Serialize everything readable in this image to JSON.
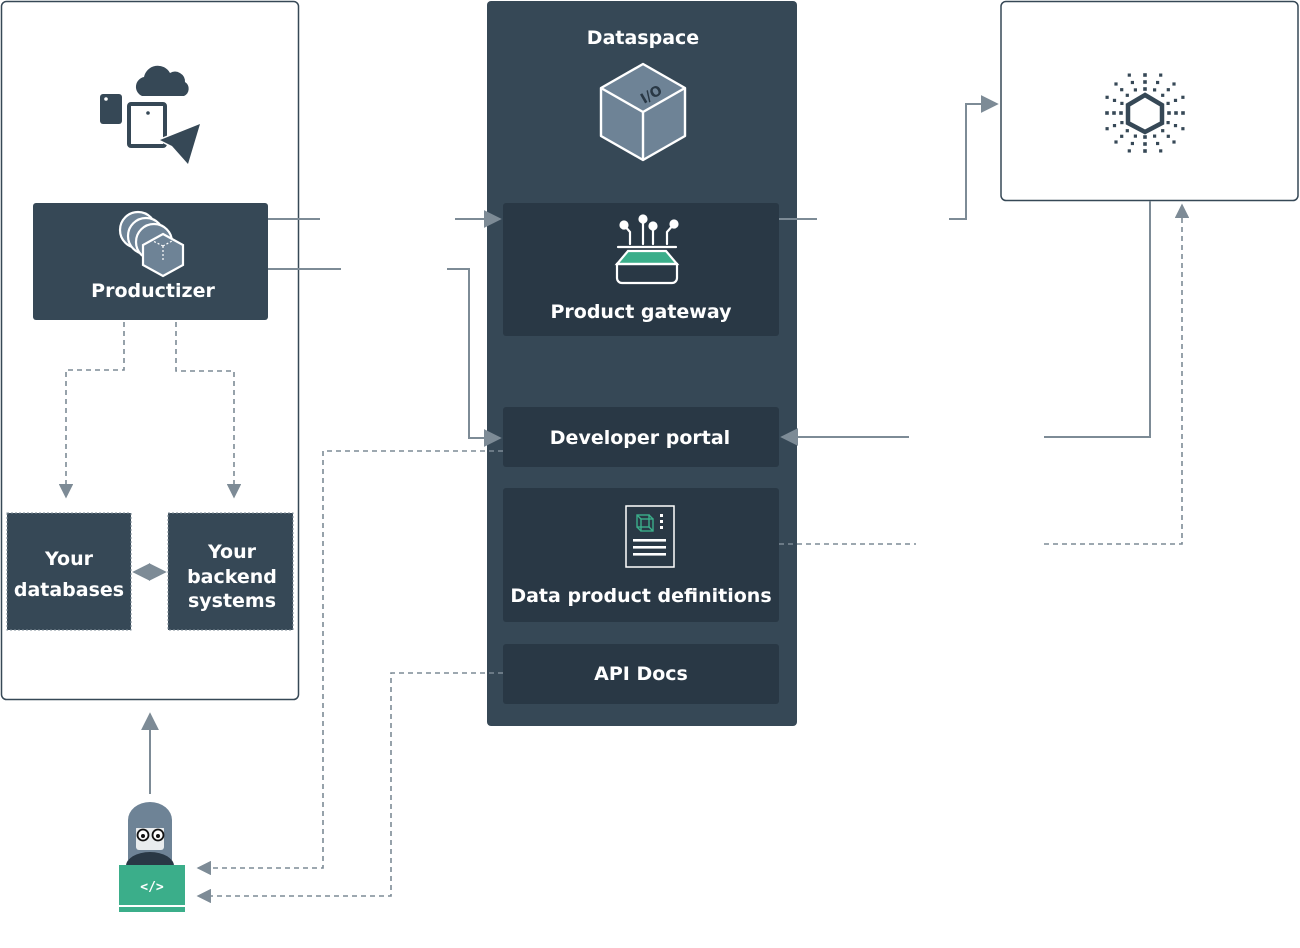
{
  "diagram": {
    "colors": {
      "panel_dark": "#364856",
      "box_dark": "#293845",
      "icon_slate": "#6e8396",
      "accent_green": "#3bae8a",
      "connector": "#7d8b96",
      "outline": "#364856"
    },
    "left_panel": {
      "icon": "devices-cloud-send-icon",
      "productizer": {
        "label": "Productizer",
        "icon": "productizer-stack-icon"
      },
      "databases": {
        "line1": "Your",
        "line2": "databases"
      },
      "backend": {
        "line1": "Your",
        "line2": "backend",
        "line3": "systems"
      }
    },
    "dataspace": {
      "title": "Dataspace",
      "icon": "io-cube-icon",
      "product_gateway": {
        "label": "Product gateway",
        "icon": "gateway-icon"
      },
      "developer_portal": {
        "label": "Developer portal"
      },
      "data_product_definitions": {
        "label": "Data product definitions",
        "icon": "definition-document-icon"
      },
      "api_docs": {
        "label": "API Docs"
      }
    },
    "right_panel": {
      "icon": "hexagon-burst-icon"
    },
    "developer": {
      "icon": "developer-avatar-icon",
      "laptop_code": "</>"
    }
  }
}
